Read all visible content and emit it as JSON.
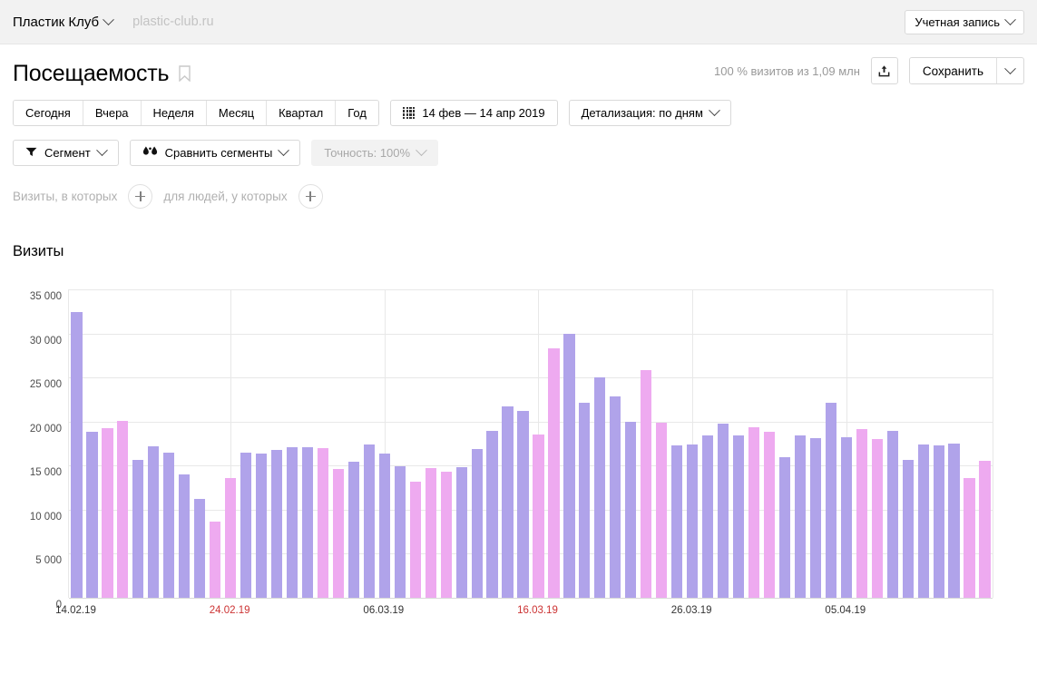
{
  "topbar": {
    "site_name": "Пластик Клуб",
    "site_url": "plastic-club.ru",
    "account_label": "Учетная запись",
    "chevron_icon": "chevron-down-icon"
  },
  "header": {
    "title": "Посещаемость",
    "bookmark_icon": "bookmark-icon",
    "visits_meta": "100 % визитов из 1,09 млн",
    "share_icon": "share-upload-icon",
    "save_label": "Сохранить",
    "save_caret_icon": "chevron-down-icon"
  },
  "period_toolbar": {
    "buttons": [
      {
        "label": "Сегодня"
      },
      {
        "label": "Вчера"
      },
      {
        "label": "Неделя"
      },
      {
        "label": "Месяц"
      },
      {
        "label": "Квартал"
      },
      {
        "label": "Год"
      }
    ],
    "date_range": "14 фев — 14 апр 2019",
    "calendar_icon": "calendar-grid-icon",
    "detail_label": "Детализация: по дням"
  },
  "segment_toolbar": {
    "segment_label": "Сегмент",
    "segment_icon": "funnel-icon",
    "compare_label": "Сравнить сегменты",
    "compare_icon": "compare-drops-icon",
    "accuracy_label": "Точность: 100%"
  },
  "filters": {
    "visits_label": "Визиты, в которых",
    "people_label": "для людей, у которых",
    "add_icon": "plus-icon"
  },
  "colors": {
    "weekday_bar": "#b0a3ea",
    "weekend_bar": "#eeaaf0",
    "grid": "#e8e8e8",
    "weekend_label": "#cc3333",
    "muted_text": "#b0b0b0"
  },
  "chart_data": {
    "type": "bar",
    "title": "Визиты",
    "xlabel": "",
    "ylabel": "",
    "ylim": [
      0,
      35000
    ],
    "yticks": [
      0,
      5000,
      10000,
      15000,
      20000,
      25000,
      30000,
      35000
    ],
    "ytick_labels": [
      "0",
      "5 000",
      "10 000",
      "15 000",
      "20 000",
      "25 000",
      "30 000",
      "35 000"
    ],
    "grid": true,
    "legend": "none",
    "x_tick_labels": [
      {
        "label": "14.02.19",
        "index": 0,
        "weekend": false
      },
      {
        "label": "24.02.19",
        "index": 10,
        "weekend": true
      },
      {
        "label": "06.03.19",
        "index": 20,
        "weekend": false
      },
      {
        "label": "16.03.19",
        "index": 30,
        "weekend": true
      },
      {
        "label": "26.03.19",
        "index": 40,
        "weekend": false
      },
      {
        "label": "05.04.19",
        "index": 50,
        "weekend": false
      }
    ],
    "categories": [
      "14.02.19",
      "15.02.19",
      "16.02.19",
      "17.02.19",
      "18.02.19",
      "19.02.19",
      "20.02.19",
      "21.02.19",
      "22.02.19",
      "23.02.19",
      "24.02.19",
      "25.02.19",
      "26.02.19",
      "27.02.19",
      "28.02.19",
      "01.03.19",
      "02.03.19",
      "03.03.19",
      "04.03.19",
      "05.03.19",
      "06.03.19",
      "07.03.19",
      "08.03.19",
      "09.03.19",
      "10.03.19",
      "11.03.19",
      "12.03.19",
      "13.03.19",
      "14.03.19",
      "15.03.19",
      "16.03.19",
      "17.03.19",
      "18.03.19",
      "19.03.19",
      "20.03.19",
      "21.03.19",
      "22.03.19",
      "23.03.19",
      "24.03.19",
      "25.03.19",
      "26.03.19",
      "27.03.19",
      "28.03.19",
      "29.03.19",
      "30.03.19",
      "31.03.19",
      "01.04.19",
      "02.04.19",
      "03.04.19",
      "04.04.19",
      "05.04.19",
      "06.04.19",
      "07.04.19",
      "08.04.19",
      "09.04.19",
      "10.04.19",
      "11.04.19",
      "12.04.19",
      "13.04.19",
      "14.04.19"
    ],
    "values": [
      32400,
      18800,
      19300,
      20100,
      15700,
      17200,
      16500,
      14000,
      11200,
      8600,
      13600,
      16500,
      16400,
      16800,
      17100,
      17100,
      17000,
      14600,
      15400,
      17400,
      16400,
      14900,
      13200,
      14700,
      14300,
      14800,
      16900,
      18900,
      21700,
      21200,
      18500,
      28300,
      30000,
      22100,
      25000,
      22900,
      20000,
      25800,
      19900,
      17300,
      17400,
      18400,
      19800,
      18400,
      19400,
      18800,
      16000,
      18400,
      18100,
      22100,
      18200,
      19200,
      18000,
      18900,
      15700,
      17400,
      17300,
      17500,
      13600,
      15500
    ],
    "weekend_flags": [
      false,
      false,
      true,
      true,
      false,
      false,
      false,
      false,
      false,
      true,
      true,
      false,
      false,
      false,
      false,
      false,
      true,
      true,
      false,
      false,
      false,
      false,
      true,
      true,
      true,
      false,
      false,
      false,
      false,
      false,
      true,
      true,
      false,
      false,
      false,
      false,
      false,
      true,
      true,
      false,
      false,
      false,
      false,
      false,
      true,
      true,
      false,
      false,
      false,
      false,
      false,
      true,
      true,
      false,
      false,
      false,
      false,
      false,
      true,
      true
    ]
  }
}
